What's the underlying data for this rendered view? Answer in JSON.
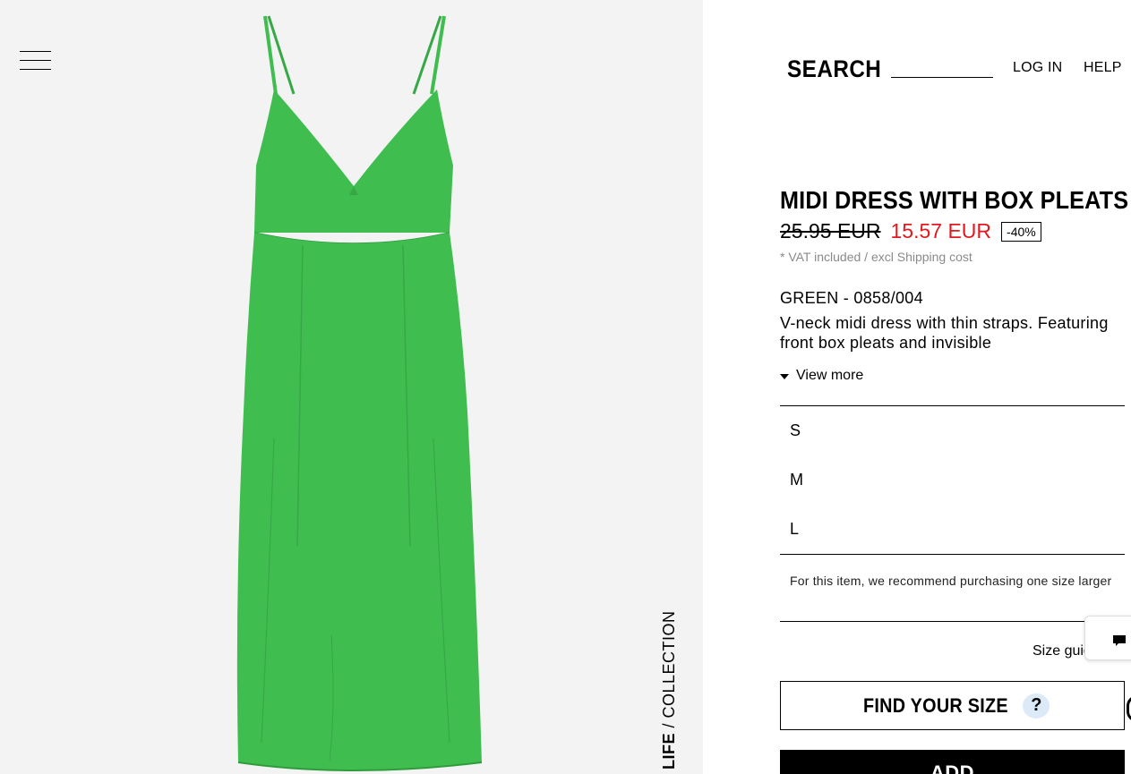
{
  "header": {
    "search_label": "SEARCH",
    "login_label": "LOG IN",
    "help_label": "HELP"
  },
  "gallery": {
    "collection_bold": "LIFE",
    "collection_light": " / COLLECTION",
    "dress_color": "#3fbe4f"
  },
  "product": {
    "title": "MIDI DRESS WITH BOX PLEATS",
    "old_price": "25.95 EUR",
    "new_price": "15.57 EUR",
    "discount": "-40%",
    "vat_note": "* VAT included / excl Shipping cost",
    "color_ref": "GREEN - 0858/004",
    "description": "V-neck midi dress with thin straps. Featuring front box pleats and invisible",
    "view_more_label": "View more",
    "sale_color": "#e0191f"
  },
  "sizes": [
    "S",
    "M",
    "L"
  ],
  "size_recommendation": "For this item, we recommend purchasing one size larger",
  "size_guide_label": "Size guide",
  "find_your_size": {
    "label": "FIND YOUR SIZE",
    "help_glyph": "?"
  },
  "add_button_label": "ADD"
}
